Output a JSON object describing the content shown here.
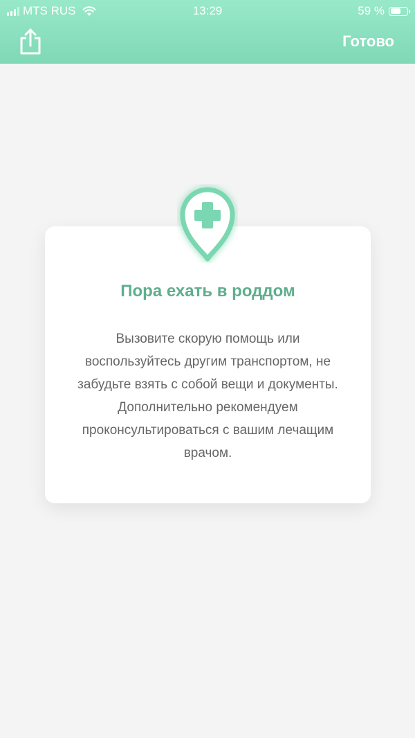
{
  "status_bar": {
    "carrier": "MTS RUS",
    "time": "13:29",
    "battery": "59 %",
    "battery_level": 0.59
  },
  "header": {
    "done_label": "Готово",
    "share_icon": "share-icon"
  },
  "card": {
    "icon": "medical-pin-icon",
    "title": "Пора ехать в роддом",
    "body": "Вызовите скорую помощь или воспользуйтесь другим транспортом, не забудьте взять с собой вещи и документы. Дополнительно рекомендуем проконсультироваться с вашим лечащим врачом."
  },
  "colors": {
    "header": "#8fe2c1",
    "accent": "#5fae8d",
    "pin": "#7ad7b1"
  }
}
